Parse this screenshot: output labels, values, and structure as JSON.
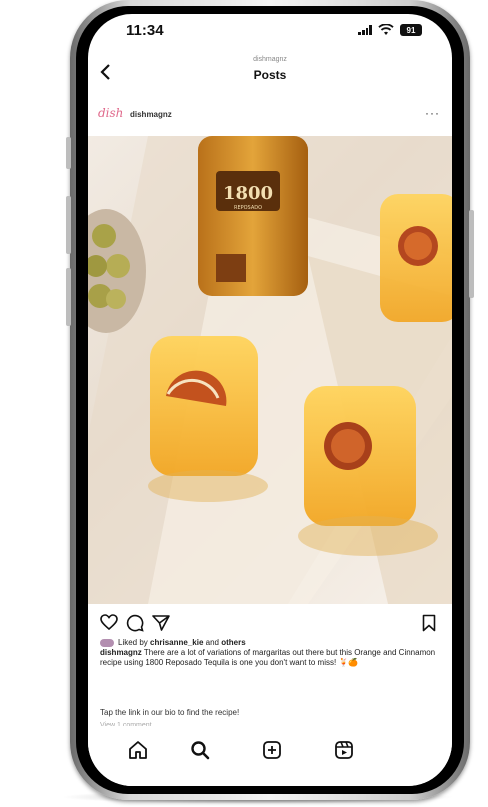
{
  "status_bar": {
    "time": "11:34",
    "battery": "91"
  },
  "header": {
    "subtitle": "dishmagnz",
    "title": "Posts",
    "back_icon": "chevron-left-icon"
  },
  "post": {
    "avatar_text": "dish",
    "username": "dishmagnz",
    "more": "···",
    "bottle_label": "1800",
    "bottle_sublabel": "REPOSADO"
  },
  "actions": {
    "like_icon": "heart-icon",
    "comment_icon": "comment-icon",
    "share_icon": "send-icon",
    "save_icon": "bookmark-icon"
  },
  "caption": {
    "liked_prefix": "Liked by ",
    "liked_user": "chrisanne_kie",
    "liked_middle": " and ",
    "liked_others": "others",
    "author": "dishmagnz",
    "text": " There are a lot of variations of margaritas out there but this Orange and Cinnamon recipe using 1800 Reposado Tequila is one you don't want to miss!",
    "emoji": "🍹🍊",
    "bio_line": "Tap the link in our bio to find the recipe!",
    "view_comments": "View 1 comment"
  },
  "tabbar": {
    "items": [
      "home-icon",
      "search-icon",
      "create-icon",
      "reels-icon"
    ]
  }
}
